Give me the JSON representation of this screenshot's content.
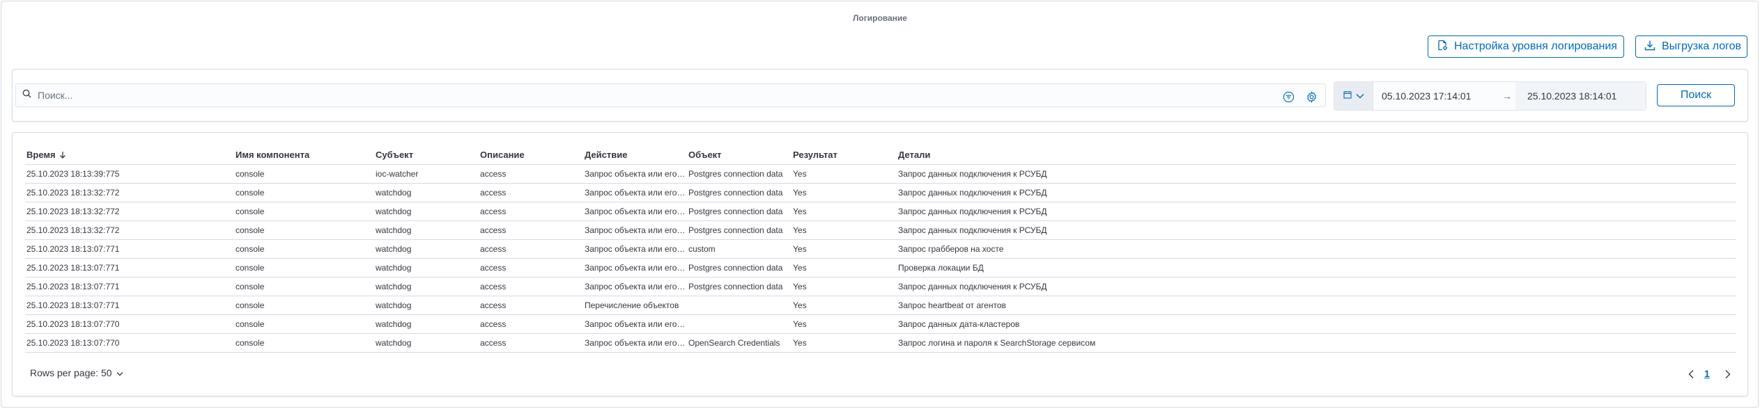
{
  "app": {
    "title": "Логирование"
  },
  "actions": {
    "log_settings_label": "Настройка уровня логирования",
    "export_label": "Выгрузка логов"
  },
  "filter": {
    "search_placeholder": "Поиск...",
    "date_start": "05.10.2023 17:14:01",
    "date_arrow": "→",
    "date_end": "25.10.2023 18:14:01",
    "search_button": "Поиск"
  },
  "table": {
    "columns": [
      "Время",
      "Имя компонента",
      "Субъект",
      "Описание",
      "Действие",
      "Объект",
      "Результат",
      "Детали"
    ],
    "sort_column": "Время",
    "rows": [
      [
        "25.10.2023 18:13:39:775",
        "console",
        "ioc-watcher",
        "access",
        "Запрос объекта или его ...",
        "Postgres connection data",
        "Yes",
        "Запрос данных подключения к РСУБД"
      ],
      [
        "25.10.2023 18:13:32:772",
        "console",
        "watchdog",
        "access",
        "Запрос объекта или его ...",
        "Postgres connection data",
        "Yes",
        "Запрос данных подключения к РСУБД"
      ],
      [
        "25.10.2023 18:13:32:772",
        "console",
        "watchdog",
        "access",
        "Запрос объекта или его ...",
        "Postgres connection data",
        "Yes",
        "Запрос данных подключения к РСУБД"
      ],
      [
        "25.10.2023 18:13:32:772",
        "console",
        "watchdog",
        "access",
        "Запрос объекта или его ...",
        "Postgres connection data",
        "Yes",
        "Запрос данных подключения к РСУБД"
      ],
      [
        "25.10.2023 18:13:07:771",
        "console",
        "watchdog",
        "access",
        "Запрос объекта или его ...",
        "custom",
        "Yes",
        "Запрос грабберов на хосте"
      ],
      [
        "25.10.2023 18:13:07:771",
        "console",
        "watchdog",
        "access",
        "Запрос объекта или его ...",
        "Postgres connection data",
        "Yes",
        "Проверка локации БД"
      ],
      [
        "25.10.2023 18:13:07:771",
        "console",
        "watchdog",
        "access",
        "Запрос объекта или его ...",
        "Postgres connection data",
        "Yes",
        "Запрос данных подключения к РСУБД"
      ],
      [
        "25.10.2023 18:13:07:771",
        "console",
        "watchdog",
        "access",
        "Перечисление объектов",
        "",
        "Yes",
        "Запрос heartbeat от агентов"
      ],
      [
        "25.10.2023 18:13:07:770",
        "console",
        "watchdog",
        "access",
        "Запрос объекта или его ...",
        "",
        "Yes",
        "Запрос данных дата-кластеров"
      ],
      [
        "25.10.2023 18:13:07:770",
        "console",
        "watchdog",
        "access",
        "Запрос объекта или его ...",
        "OpenSearch Credentials",
        "Yes",
        "Запрос логина и пароля к SearchStorage сервисом"
      ]
    ]
  },
  "pagination": {
    "rows_per_page_label": "Rows per page: 50",
    "current_page": "1"
  },
  "icons": {
    "search": "search-icon",
    "filter": "filter-icon",
    "settings": "gear-icon",
    "calendar": "calendar-icon",
    "chevron": "chevron-down-icon",
    "download": "download-icon",
    "log_settings": "document-settings-icon",
    "sort": "arrow-down-icon",
    "prev": "chevron-left-icon",
    "next": "chevron-right-icon"
  },
  "colors": {
    "accent": "#006bb8",
    "text": "#343741",
    "muted": "#69707d",
    "border": "#d3dae6"
  }
}
